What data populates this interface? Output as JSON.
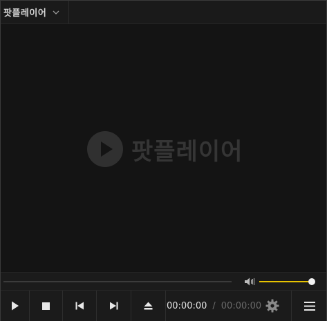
{
  "titlebar": {
    "app_name": "팟플레이어",
    "menu_icon": "chevron-down-icon"
  },
  "video": {
    "logo_text": "팟플레이어",
    "logo_icon": "play-circle-icon"
  },
  "seekbar": {
    "progress": 0,
    "volume": 0.98,
    "volume_icon": "speaker-icon",
    "volume_color": "#e6c200"
  },
  "controls": {
    "current_time": "00:00:00",
    "separator": "/",
    "duration": "00:00:00",
    "buttons": [
      "play-icon",
      "stop-icon",
      "previous-icon",
      "next-icon",
      "eject-icon",
      "gear-icon",
      "menu-icon"
    ]
  }
}
